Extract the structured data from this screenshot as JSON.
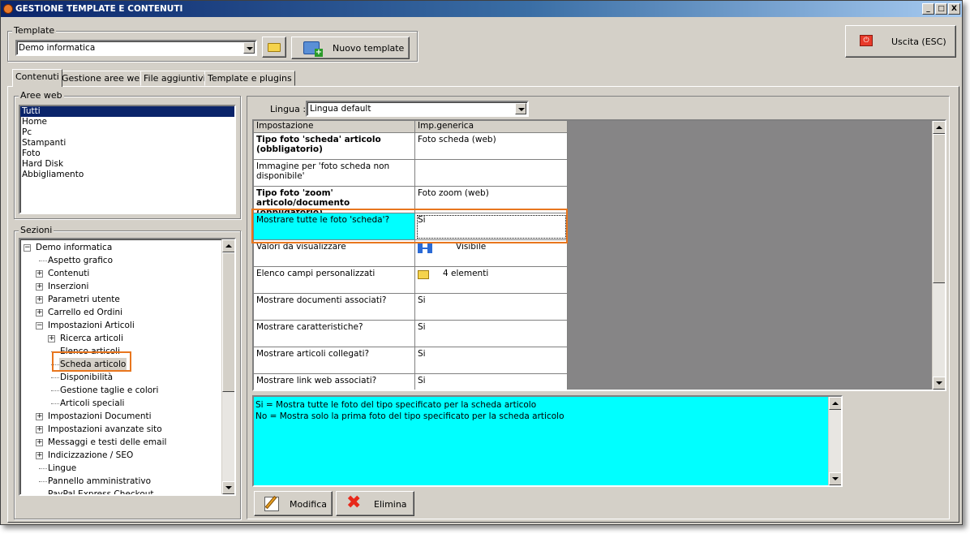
{
  "window": {
    "title": "GESTIONE TEMPLATE E CONTENUTI",
    "controls": [
      "_",
      "□",
      "X"
    ]
  },
  "template_group": {
    "label": "Template",
    "selected": "Demo informatica",
    "new_button": "Nuovo template"
  },
  "exit_button": "Uscita (ESC)",
  "tabs": [
    "Contenuti",
    "Gestione aree web",
    "File aggiuntivi",
    "Template e plugins"
  ],
  "aree_web": {
    "label": "Aree web",
    "items": [
      "Tutti",
      "Home",
      "Pc",
      "Stampanti",
      "Foto",
      "Hard Disk",
      "Abbigliamento"
    ],
    "selected_index": 0
  },
  "sezioni": {
    "label": "Sezioni",
    "tree": [
      {
        "label": "Demo informatica",
        "level": 0,
        "expander": "-"
      },
      {
        "label": "Aspetto grafico",
        "level": 1,
        "expander": ""
      },
      {
        "label": "Contenuti",
        "level": 1,
        "expander": "+"
      },
      {
        "label": "Inserzioni",
        "level": 1,
        "expander": "+"
      },
      {
        "label": "Parametri utente",
        "level": 1,
        "expander": "+"
      },
      {
        "label": "Carrello ed Ordini",
        "level": 1,
        "expander": "+"
      },
      {
        "label": "Impostazioni Articoli",
        "level": 1,
        "expander": "-"
      },
      {
        "label": "Ricerca articoli",
        "level": 2,
        "expander": "+"
      },
      {
        "label": "Elenco articoli",
        "level": 2,
        "expander": ""
      },
      {
        "label": "Scheda articolo",
        "level": 2,
        "expander": "",
        "selected": true
      },
      {
        "label": "Disponibilità",
        "level": 2,
        "expander": ""
      },
      {
        "label": "Gestione taglie e colori",
        "level": 2,
        "expander": ""
      },
      {
        "label": "Articoli speciali",
        "level": 2,
        "expander": ""
      },
      {
        "label": "Impostazioni Documenti",
        "level": 1,
        "expander": "+"
      },
      {
        "label": "Impostazioni avanzate sito",
        "level": 1,
        "expander": "+"
      },
      {
        "label": "Messaggi e testi delle email",
        "level": 1,
        "expander": "+"
      },
      {
        "label": "Indicizzazione / SEO",
        "level": 1,
        "expander": "+"
      },
      {
        "label": "Lingue",
        "level": 1,
        "expander": ""
      },
      {
        "label": "Pannello amministrativo",
        "level": 1,
        "expander": ""
      },
      {
        "label": "PayPal Express Checkout",
        "level": 1,
        "expander": ""
      }
    ]
  },
  "lingua": {
    "label": "Lingua :",
    "selected": "Lingua default"
  },
  "grid": {
    "headers": [
      "Impostazione",
      "Imp.generica"
    ],
    "rows": [
      {
        "setting": "Tipo foto 'scheda' articolo (obbligatorio)",
        "value": "Foto scheda (web)",
        "bold": true
      },
      {
        "setting": "Immagine per 'foto scheda non disponibile'",
        "value": "",
        "bold": false
      },
      {
        "setting": "Tipo foto 'zoom' articolo/documento (obbligatorio)",
        "value": "Foto zoom (web)",
        "bold": true
      },
      {
        "setting": "Mostrare tutte le foto 'scheda'?",
        "value": "Si",
        "bold": false,
        "selected": true
      },
      {
        "setting": "Valori da visualizzare",
        "value": "Visibile",
        "bold": false,
        "icon": "hierarchy-icon"
      },
      {
        "setting": "Elenco campi personalizzati",
        "value": "4 elementi",
        "bold": false,
        "icon": "folder-icon"
      },
      {
        "setting": "Mostrare documenti associati?",
        "value": "Si",
        "bold": false
      },
      {
        "setting": "Mostrare caratteristiche?",
        "value": "Si",
        "bold": false
      },
      {
        "setting": "Mostrare articoli collegati?",
        "value": "Si",
        "bold": false
      },
      {
        "setting": "Mostrare link web associati?",
        "value": "Si",
        "bold": false
      }
    ]
  },
  "description": {
    "lines": [
      "Si = Mostra tutte le foto del tipo specificato per la scheda articolo",
      "No = Mostra solo la prima foto del tipo specificato per la scheda articolo"
    ]
  },
  "actions": {
    "edit": "Modifica",
    "delete": "Elimina"
  },
  "colors": {
    "description_bg": "#00ffff",
    "selected_row_bg": "#00ffff",
    "highlight": "#e8761e",
    "grid_empty_bg": "#868586"
  }
}
